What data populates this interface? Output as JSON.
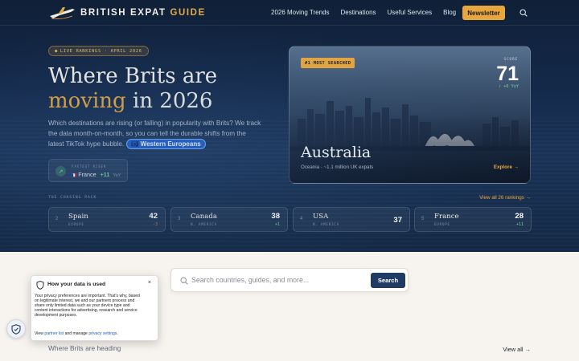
{
  "nav": {
    "logo_main": "BRITISH EXPAT ",
    "logo_accent": "GUIDE",
    "links": [
      "2026 Moving Trends",
      "Destinations",
      "Useful Services",
      "Blog"
    ],
    "newsletter": "Newsletter",
    "search_icon": "search-icon"
  },
  "hero": {
    "live_label": "LIVE RANKINGS · APRIL 2026",
    "headline_line1": "Where Brits are",
    "headline_gold": "moving",
    "headline_rest": " in 2026",
    "subtitle": "Which destinations are rising (or falling) in popularity with Brits? We track the data month-on-month, so you can tell the durable shifts from the latest TikTok hype bubble.",
    "subtitle_tag": "🇪🇺 Western Europeans",
    "riser": {
      "caption": "FASTEST RISER",
      "flag": "🇫🇷",
      "country": "France",
      "delta": "+11",
      "unit": "YoY"
    }
  },
  "feature": {
    "badge": "#1 MOST SEARCHED",
    "score_label": "SCORE",
    "score": "71",
    "delta": "↑ +6 YoY",
    "name": "Australia",
    "meta": "Oceania · ~1.1 million UK expats",
    "explore": "Explore →"
  },
  "chasing": {
    "label": "THE CHASING PACK",
    "view_all": "View all 26 rankings →",
    "items": [
      {
        "rank": "2",
        "name": "Spain",
        "region": "EUROPE",
        "score": "42",
        "delta": "-3",
        "dir": "neg"
      },
      {
        "rank": "3",
        "name": "Canada",
        "region": "N. AMERICA",
        "score": "38",
        "delta": "+1",
        "dir": "pos"
      },
      {
        "rank": "4",
        "name": "USA",
        "region": "N. AMERICA",
        "score": "37",
        "delta": "",
        "dir": "pos"
      },
      {
        "rank": "5",
        "name": "France",
        "region": "EUROPE",
        "score": "28",
        "delta": "+11",
        "dir": "pos"
      }
    ]
  },
  "search": {
    "placeholder": "Search countries, guides, and more...",
    "button": "Search"
  },
  "section": {
    "title_fragment": "s",
    "subtitle": "Where Brits are heading",
    "view_all": "View all →"
  },
  "consent": {
    "title": "How your data is used",
    "close": "×",
    "body": "Your privacy preferences are important. That's why, based on legitimate interest, we and our partners process and share only limited data such as your device type and content interactions for advertising, research and service development purposes.",
    "foot_pre": "View ",
    "foot_link1": "partner list",
    "foot_mid": " and manage ",
    "foot_link2": "privacy settings",
    "foot_end": "."
  },
  "colors": {
    "accent": "#e8a73e",
    "navy": "#1f3a63",
    "positive": "#6fd396",
    "negative": "#e46a56"
  }
}
